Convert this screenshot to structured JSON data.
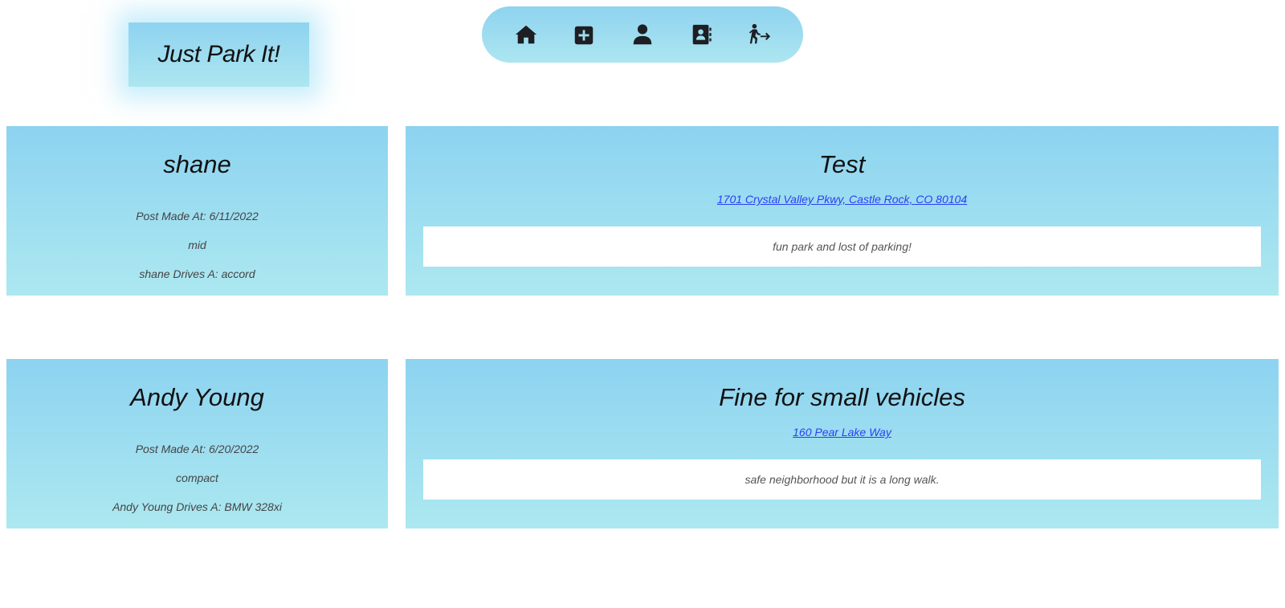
{
  "brand": {
    "title": "Just Park It!"
  },
  "nav": {
    "items": [
      {
        "name": "home",
        "icon": "home-icon"
      },
      {
        "name": "add-post",
        "icon": "plus-square-icon"
      },
      {
        "name": "profile",
        "icon": "user-icon"
      },
      {
        "name": "contacts",
        "icon": "address-book-icon"
      },
      {
        "name": "logout",
        "icon": "person-running-exit-icon"
      }
    ]
  },
  "posts": [
    {
      "user": {
        "name": "shane",
        "post_made": "Post Made At: 6/11/2022",
        "size": "mid",
        "drives": "shane Drives A: accord"
      },
      "title": "Test",
      "address": "1701 Crystal Valley Pkwy, Castle Rock, CO 80104",
      "body": "fun park and lost of parking!"
    },
    {
      "user": {
        "name": "Andy Young",
        "post_made": "Post Made At: 6/20/2022",
        "size": "compact",
        "drives": "Andy Young Drives A: BMW 328xi"
      },
      "title": "Fine for small vehicles",
      "address": "160 Pear Lake Way",
      "body": "safe neighborhood but it is a long walk."
    }
  ],
  "colors": {
    "gradient_top": "#8dd3f0",
    "gradient_bottom": "#ace8f0",
    "link": "#2a3ff5",
    "icon": "#1d1f22"
  }
}
